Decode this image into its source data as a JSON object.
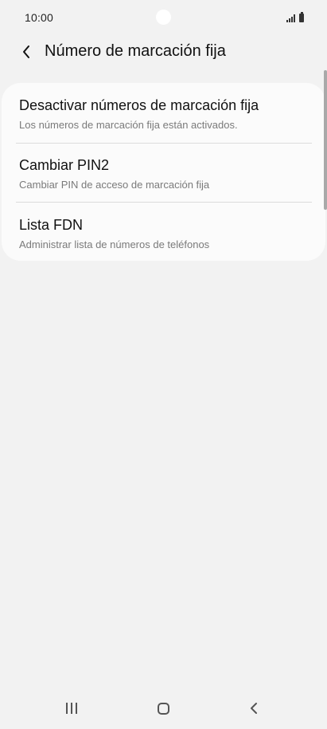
{
  "status_bar": {
    "time": "10:00",
    "icons": [
      "signal-icon",
      "battery-icon"
    ]
  },
  "header": {
    "title": "Número de marcación fija",
    "back_icon": "chevron-left-icon"
  },
  "settings": {
    "items": [
      {
        "title": "Desactivar números de marcación fija",
        "subtitle": "Los números de marcación fija están activados."
      },
      {
        "title": "Cambiar PIN2",
        "subtitle": "Cambiar PIN de acceso de marcación fija"
      },
      {
        "title": "Lista FDN",
        "subtitle": "Administrar lista de números de teléfonos"
      }
    ]
  },
  "nav_bar": {
    "icons": [
      "recent-apps-icon",
      "home-icon",
      "back-icon"
    ]
  },
  "colors": {
    "background": "#f2f2f2",
    "card": "#fbfbfb",
    "primary_text": "#111111",
    "secondary_text": "#7a7a7a",
    "divider": "#dcdcdc"
  }
}
